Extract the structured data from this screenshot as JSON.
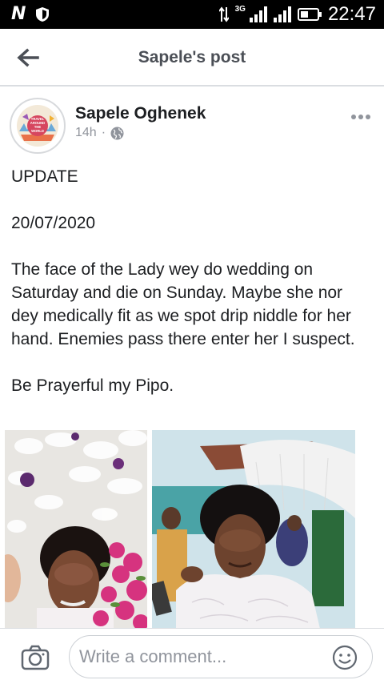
{
  "status_bar": {
    "time": "22:47",
    "network_type": "3G",
    "icons": [
      "n-app-icon",
      "shield-icon",
      "data-arrows-icon",
      "signal-icon",
      "signal-icon",
      "battery-icon"
    ]
  },
  "header": {
    "title": "Sapele's post",
    "back_icon": "arrow-left-icon"
  },
  "post": {
    "author": "Sapele Oghenek",
    "time_ago": "14h",
    "separator": "·",
    "audience_icon": "globe-icon",
    "avatar_text": [
      "TRAVEL",
      "AROUND",
      "THE",
      "WORLD"
    ],
    "paragraphs": [
      "UPDATE",
      "20/07/2020",
      "The face of the Lady wey do wedding on Saturday and die on Sunday. Maybe she nor dey medically fit as we spot drip niddle for her hand. Enemies pass there enter her I suspect.",
      "Be Prayerful my Pipo."
    ]
  },
  "comment_bar": {
    "placeholder": "Write a comment...",
    "camera_icon": "camera-icon",
    "emoji_icon": "smiley-icon"
  },
  "colors": {
    "status_bar_bg": "#000000",
    "header_title": "#4b4f56",
    "meta_gray": "#90949c",
    "divider": "#dadde1"
  }
}
